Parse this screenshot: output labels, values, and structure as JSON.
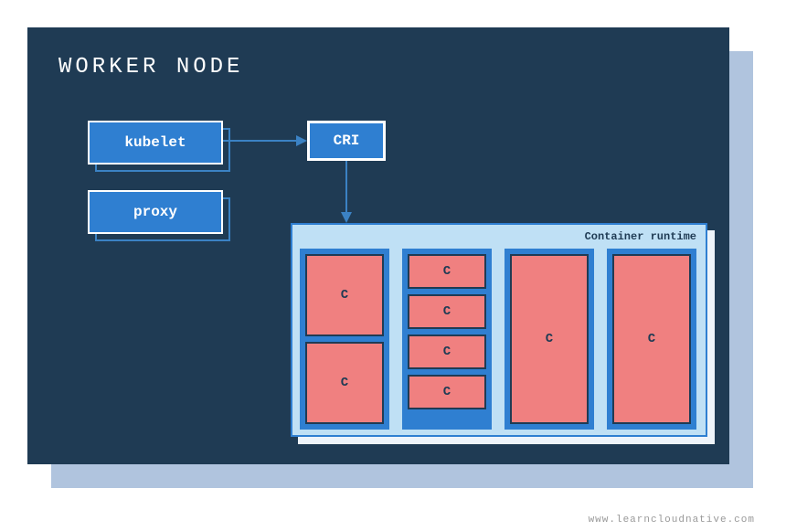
{
  "title": "WORKER NODE",
  "kubelet": {
    "label": "kubelet"
  },
  "proxy": {
    "label": "proxy"
  },
  "cri": {
    "label": "CRI"
  },
  "runtime": {
    "label": "Container runtime",
    "pods": [
      {
        "containers": [
          "C",
          "C"
        ]
      },
      {
        "containers": [
          "C",
          "C",
          "C",
          "C"
        ]
      },
      {
        "containers": [
          "C"
        ]
      },
      {
        "containers": [
          "C"
        ]
      }
    ]
  },
  "attribution": "www.learncloudnative.com",
  "chart_data": {
    "type": "diagram",
    "title": "WORKER NODE",
    "nodes": [
      {
        "id": "kubelet",
        "label": "kubelet"
      },
      {
        "id": "proxy",
        "label": "proxy"
      },
      {
        "id": "cri",
        "label": "CRI"
      },
      {
        "id": "runtime",
        "label": "Container runtime",
        "children": [
          {
            "id": "pod1",
            "containers": 2
          },
          {
            "id": "pod2",
            "containers": 4
          },
          {
            "id": "pod3",
            "containers": 1
          },
          {
            "id": "pod4",
            "containers": 1
          }
        ]
      }
    ],
    "edges": [
      {
        "from": "kubelet",
        "to": "cri"
      },
      {
        "from": "cri",
        "to": "runtime"
      }
    ]
  }
}
